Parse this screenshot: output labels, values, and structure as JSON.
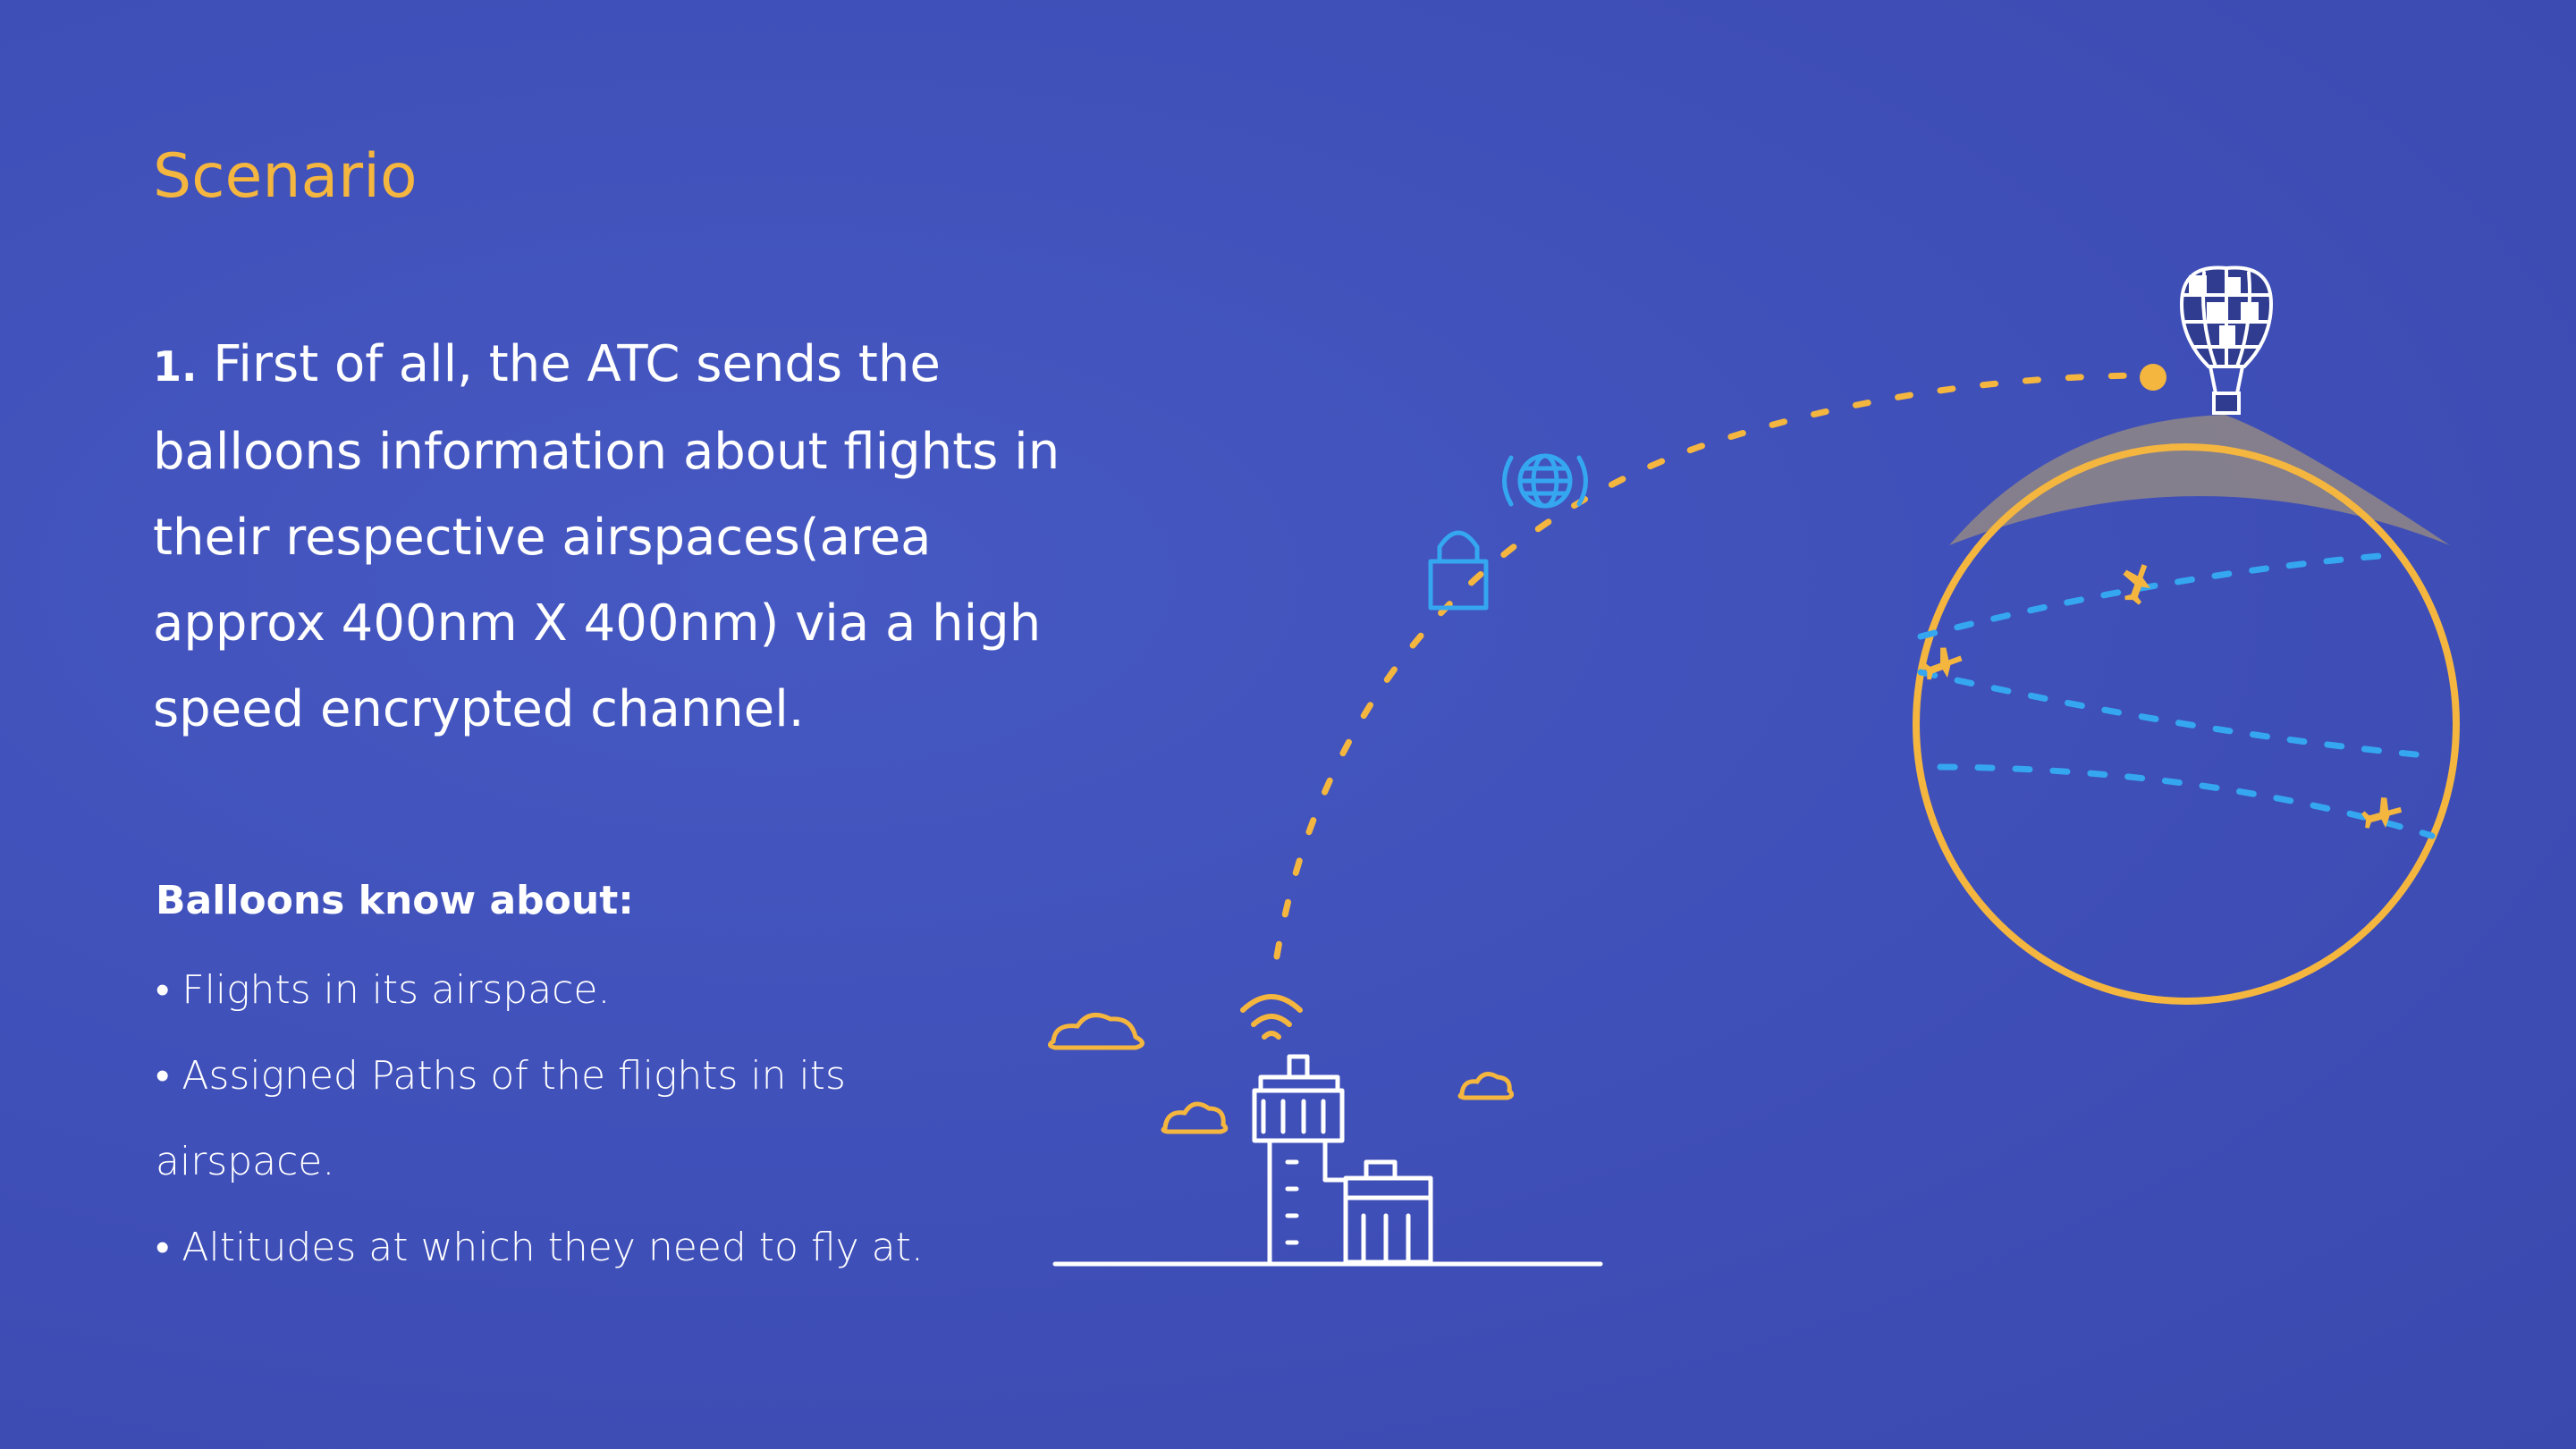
{
  "slide": {
    "title": "Scenario",
    "step_number": "1.",
    "step_text": "First of all, the ATC sends the balloons information about flights in their respective airspaces(area approx 400nm X 400nm) via a high speed encrypted channel.",
    "balloons_heading": "Balloons know about:",
    "bullets": [
      "• Flights in its airspace.",
      "• Assigned Paths of the flights in its airspace.",
      "• Altitudes at which they need to fly at."
    ]
  },
  "colors": {
    "background": "#3f4fb8",
    "accent_yellow": "#f4b63f",
    "path_blue": "#35a7f0",
    "chalk_white": "#ffffff"
  },
  "icons": {
    "tower": "air-traffic-control-tower-icon",
    "signal": "wifi-signal-icon",
    "lock": "lock-icon",
    "globe": "globe-icon",
    "balloon": "hot-air-balloon-icon",
    "airplane": "airplane-icon",
    "cloud": "cloud-icon"
  }
}
